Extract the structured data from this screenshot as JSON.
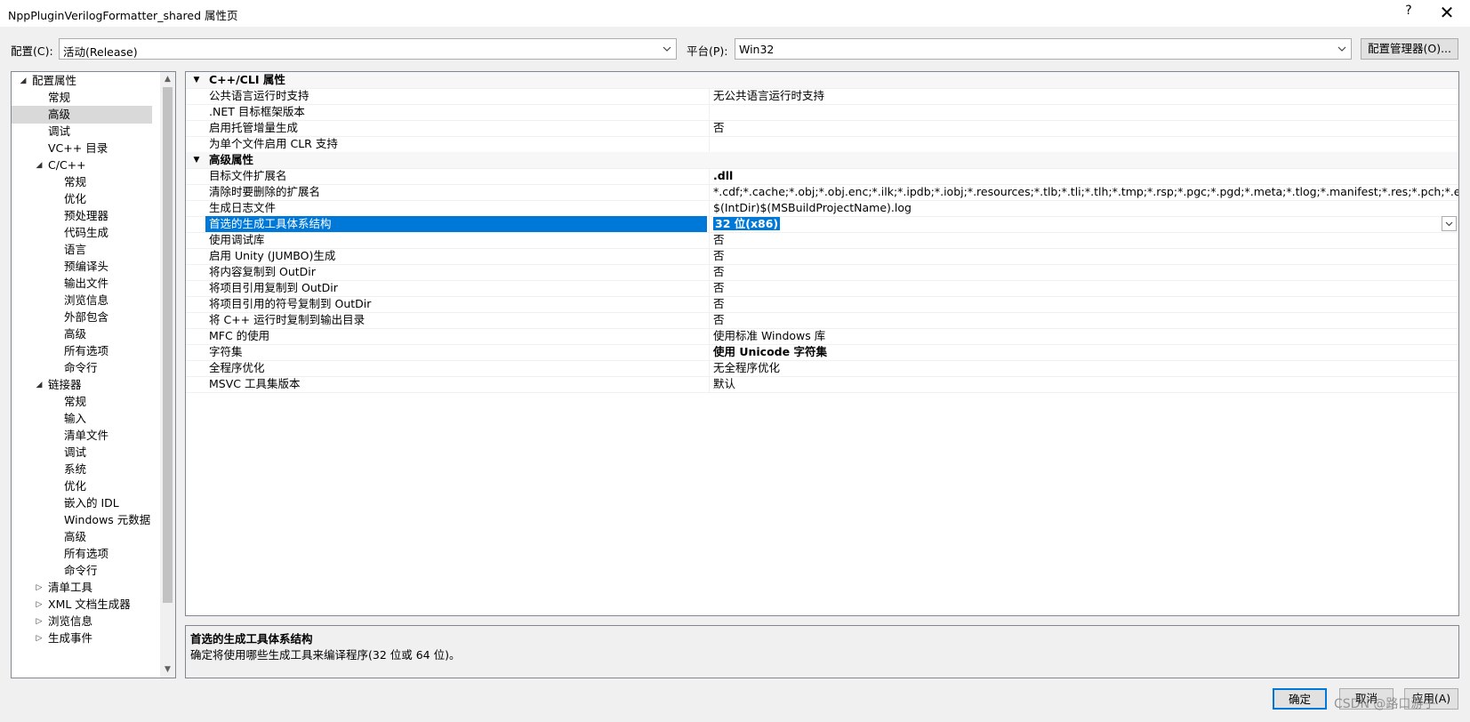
{
  "window": {
    "title": "NppPluginVerilogFormatter_shared 属性页",
    "help_label": "?",
    "close_label": "✕"
  },
  "config": {
    "config_label": "配置(C):",
    "config_value": "活动(Release)",
    "platform_label": "平台(P):",
    "platform_value": "Win32",
    "manager_button": "配置管理器(O)..."
  },
  "tree": {
    "items": [
      {
        "label": "配置属性",
        "toggle": "◢"
      },
      {
        "label": "常规"
      },
      {
        "label": "高级"
      },
      {
        "label": "调试"
      },
      {
        "label": "VC++ 目录"
      },
      {
        "label": "C/C++",
        "toggle": "◢"
      },
      {
        "label": "常规"
      },
      {
        "label": "优化"
      },
      {
        "label": "预处理器"
      },
      {
        "label": "代码生成"
      },
      {
        "label": "语言"
      },
      {
        "label": "预编译头"
      },
      {
        "label": "输出文件"
      },
      {
        "label": "浏览信息"
      },
      {
        "label": "外部包含"
      },
      {
        "label": "高级"
      },
      {
        "label": "所有选项"
      },
      {
        "label": "命令行"
      },
      {
        "label": "链接器",
        "toggle": "◢"
      },
      {
        "label": "常规"
      },
      {
        "label": "输入"
      },
      {
        "label": "清单文件"
      },
      {
        "label": "调试"
      },
      {
        "label": "系统"
      },
      {
        "label": "优化"
      },
      {
        "label": "嵌入的 IDL"
      },
      {
        "label": "Windows 元数据"
      },
      {
        "label": "高级"
      },
      {
        "label": "所有选项"
      },
      {
        "label": "命令行"
      },
      {
        "label": "清单工具",
        "toggle": "▷"
      },
      {
        "label": "XML 文档生成器",
        "toggle": "▷"
      },
      {
        "label": "浏览信息",
        "toggle": "▷"
      },
      {
        "label": "生成事件",
        "toggle": "▷"
      }
    ],
    "selected_index": 2
  },
  "grid": {
    "rows": [
      {
        "name": "C++/CLI 属性",
        "cat": true
      },
      {
        "name": "公共语言运行时支持",
        "value": "无公共语言运行时支持"
      },
      {
        "name": ".NET 目标框架版本",
        "value": ""
      },
      {
        "name": "启用托管增量生成",
        "value": "否"
      },
      {
        "name": "为单个文件启用 CLR 支持",
        "value": ""
      },
      {
        "name": "高级属性",
        "cat": true
      },
      {
        "name": "目标文件扩展名",
        "value": ".dll",
        "bold": true
      },
      {
        "name": "清除时要删除的扩展名",
        "value": "*.cdf;*.cache;*.obj;*.obj.enc;*.ilk;*.ipdb;*.iobj;*.resources;*.tlb;*.tli;*.tlh;*.tmp;*.rsp;*.pgc;*.pgd;*.meta;*.tlog;*.manifest;*.res;*.pch;*.exp;*.idb;*.rep;*."
      },
      {
        "name": "生成日志文件",
        "value": "$(IntDir)$(MSBuildProjectName).log"
      },
      {
        "name": "首选的生成工具体系结构",
        "value": "32 位(x86)",
        "selected": true
      },
      {
        "name": "使用调试库",
        "value": "否"
      },
      {
        "name": "启用 Unity (JUMBO)生成",
        "value": "否"
      },
      {
        "name": "将内容复制到 OutDir",
        "value": "否"
      },
      {
        "name": "将项目引用复制到 OutDir",
        "value": "否"
      },
      {
        "name": "将项目引用的符号复制到 OutDir",
        "value": "否"
      },
      {
        "name": "将 C++ 运行时复制到输出目录",
        "value": "否"
      },
      {
        "name": "MFC 的使用",
        "value": "使用标准 Windows 库"
      },
      {
        "name": "字符集",
        "value": "使用 Unicode 字符集",
        "bold": true
      },
      {
        "name": "全程序优化",
        "value": "无全程序优化"
      },
      {
        "name": "MSVC 工具集版本",
        "value": "默认"
      }
    ]
  },
  "description": {
    "title": "首选的生成工具体系结构",
    "text": "确定将使用哪些生成工具来编译程序(32 位或 64 位)。"
  },
  "footer": {
    "ok": "确定",
    "cancel": "取消",
    "apply": "应用(A)"
  },
  "watermark": "CSDN @路口游子"
}
